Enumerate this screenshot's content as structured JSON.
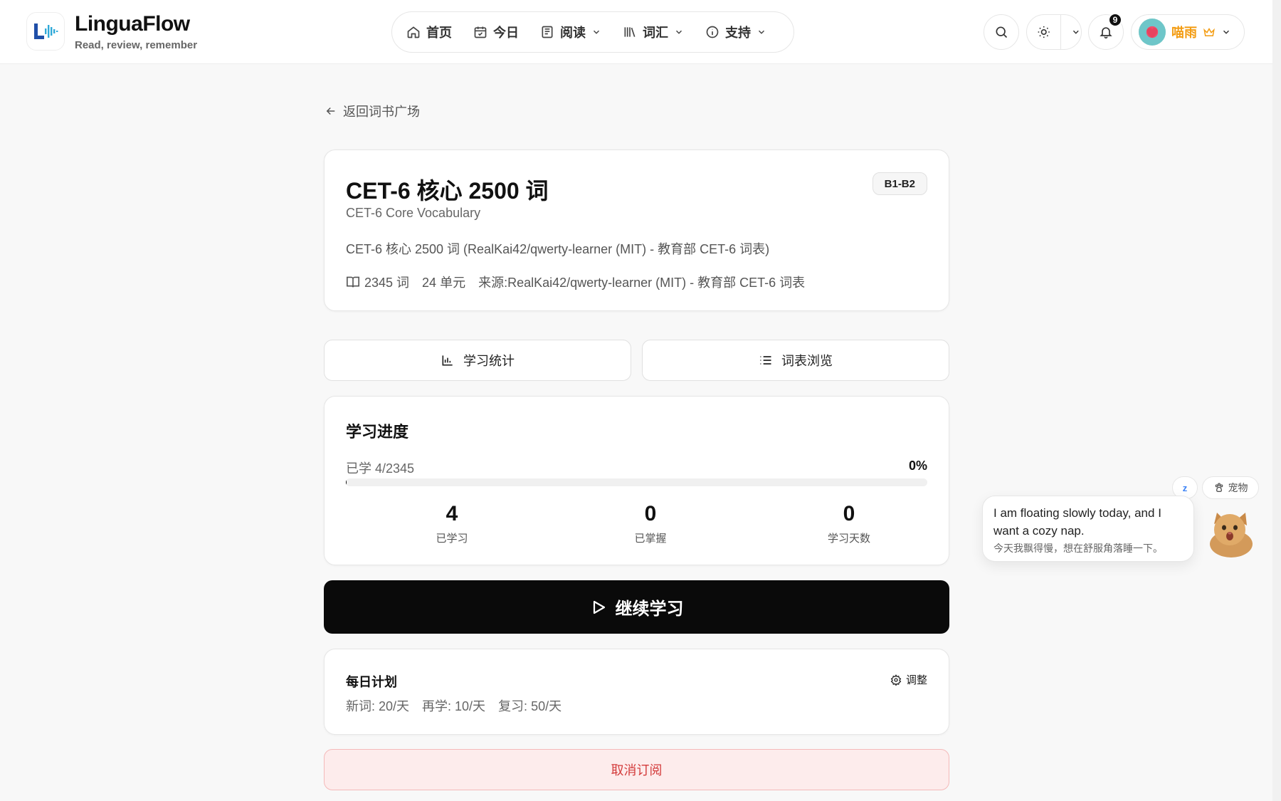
{
  "brand": {
    "title": "LinguaFlow",
    "subtitle": "Read, review, remember"
  },
  "nav": {
    "items": [
      {
        "label": "首页",
        "icon": "home-icon"
      },
      {
        "label": "今日",
        "icon": "calendar-icon"
      },
      {
        "label": "阅读",
        "icon": "newspaper-icon",
        "dropdown": true
      },
      {
        "label": "词汇",
        "icon": "library-icon",
        "dropdown": true
      },
      {
        "label": "支持",
        "icon": "info-icon",
        "dropdown": true
      }
    ]
  },
  "header": {
    "notifications_count": "9",
    "user_name": "喵雨"
  },
  "back_link": "返回词书广场",
  "book": {
    "title": "CET-6 核心 2500 词",
    "subtitle": "CET-6 Core Vocabulary",
    "description": "CET-6 核心 2500 词 (RealKai42/qwerty-learner (MIT) - 教育部 CET-6 词表)",
    "level": "B1-B2",
    "word_count": "2345 词",
    "unit_count": "24 单元",
    "source": "来源:RealKai42/qwerty-learner (MIT) - 教育部 CET-6 词表"
  },
  "tabs": {
    "stats": "学习统计",
    "browse": "词表浏览"
  },
  "progress": {
    "title": "学习进度",
    "label": "已学 4/2345",
    "percent_text": "0%",
    "fraction": 0.0017,
    "stats": [
      {
        "value": "4",
        "label": "已学习"
      },
      {
        "value": "0",
        "label": "已掌握"
      },
      {
        "value": "0",
        "label": "学习天数"
      }
    ]
  },
  "continue_label": "继续学习",
  "plan": {
    "title": "每日计划",
    "adjust": "调整",
    "new_words": "新词: 20/天",
    "relearn": "再学: 10/天",
    "review": "复习: 50/天"
  },
  "unsubscribe": "取消订阅",
  "pet": {
    "message_en": "I am floating slowly today, and I want a cozy nap.",
    "message_zh": "今天我飘得慢，想在舒服角落睡一下。",
    "toggle_label": "宠物",
    "sleep_label": "z"
  },
  "colors": {
    "accent": "#0a0a0a",
    "danger": "#d33b3b",
    "user": "#f39c12",
    "logo": "#1f4fa8"
  }
}
